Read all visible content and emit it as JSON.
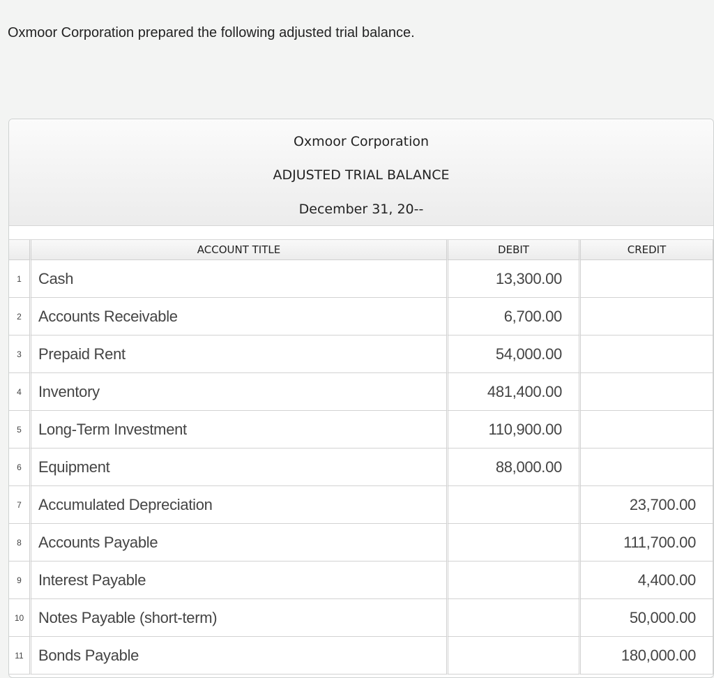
{
  "intro": "Oxmoor Corporation prepared the following adjusted trial balance.",
  "heading": {
    "company": "Oxmoor Corporation",
    "title": "ADJUSTED TRIAL BALANCE",
    "date": "December 31, 20--"
  },
  "columns": {
    "account": "ACCOUNT TITLE",
    "debit": "DEBIT",
    "credit": "CREDIT"
  },
  "rows": [
    {
      "num": "1",
      "account": "Cash",
      "debit": "13,300.00",
      "credit": ""
    },
    {
      "num": "2",
      "account": "Accounts Receivable",
      "debit": "6,700.00",
      "credit": ""
    },
    {
      "num": "3",
      "account": "Prepaid Rent",
      "debit": "54,000.00",
      "credit": ""
    },
    {
      "num": "4",
      "account": "Inventory",
      "debit": "481,400.00",
      "credit": ""
    },
    {
      "num": "5",
      "account": "Long-Term Investment",
      "debit": "110,900.00",
      "credit": ""
    },
    {
      "num": "6",
      "account": "Equipment",
      "debit": "88,000.00",
      "credit": ""
    },
    {
      "num": "7",
      "account": "Accumulated Depreciation",
      "debit": "",
      "credit": "23,700.00"
    },
    {
      "num": "8",
      "account": "Accounts Payable",
      "debit": "",
      "credit": "111,700.00"
    },
    {
      "num": "9",
      "account": "Interest Payable",
      "debit": "",
      "credit": "4,400.00"
    },
    {
      "num": "10",
      "account": "Notes Payable (short-term)",
      "debit": "",
      "credit": "50,000.00"
    },
    {
      "num": "11",
      "account": "Bonds Payable",
      "debit": "",
      "credit": "180,000.00"
    }
  ]
}
